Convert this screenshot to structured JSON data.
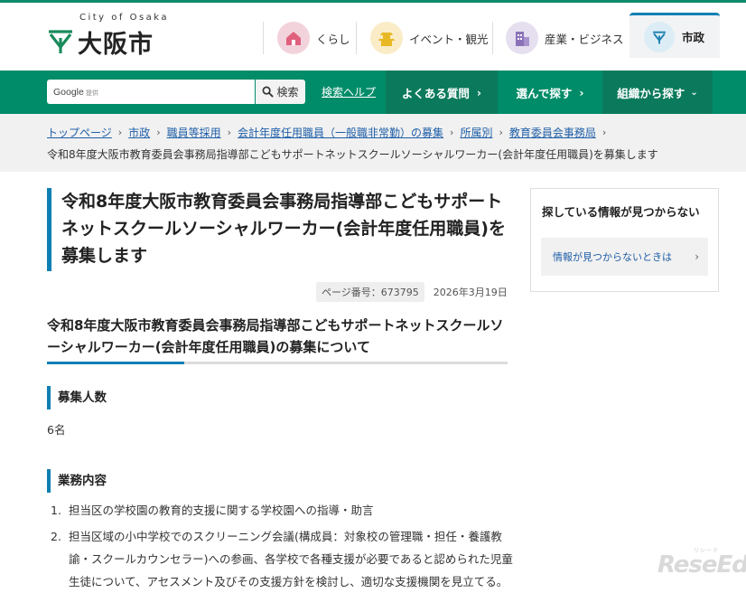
{
  "header": {
    "logo_en": "City of Osaka",
    "logo_ja": "大阪市",
    "nav": [
      {
        "label": "くらし",
        "icon": "house-icon",
        "color": "#f3d3db"
      },
      {
        "label": "イベント・観光",
        "icon": "castle-icon",
        "color": "#f9ecc7"
      },
      {
        "label": "産業・ビジネス",
        "icon": "building-icon",
        "color": "#e6dff0"
      },
      {
        "label": "市政",
        "icon": "city-emblem-icon",
        "color": "#dcedf6"
      }
    ]
  },
  "searchbar": {
    "brand": "Google",
    "brand_sub": "提供",
    "button": "検索",
    "help": "検索ヘルプ",
    "menus": [
      "よくある質問",
      "選んで探す",
      "組織から探す"
    ]
  },
  "breadcrumb": {
    "links": [
      "トップページ",
      "市政",
      "職員等採用",
      "会計年度任用職員（一般職非常勤）の募集",
      "所属別",
      "教育委員会事務局"
    ],
    "current": "令和8年度大阪市教育委員会事務局指導部こどもサポートネットスクールソーシャルワーカー(会計年度任用職員)を募集します"
  },
  "page": {
    "title": "令和8年度大阪市教育委員会事務局指導部こどもサポートネットスクールソーシャルワーカー(会計年度任用職員)を募集します",
    "page_number": "ページ番号：673795",
    "date": "2026年3月19日",
    "heading2": "令和8年度大阪市教育委員会事務局指導部こどもサポートネットスクールソーシャルワーカー(会計年度任用職員)の募集について",
    "section1_title": "募集人数",
    "section1_body": "6名",
    "section2_title": "業務内容",
    "section2_items": [
      "担当区の学校園の教育的支援に関する学校園への指導・助言",
      "担当区域の小中学校でのスクリーニング会議(構成員：対象校の管理職・担任・養護教諭・スクールカウンセラー)への参画、各学校で各種支援が必要であると認められた児童生徒について、アセスメント及びその支援方針を検討し、適切な支援機関を見立てる。"
    ]
  },
  "sidebar": {
    "title": "探している情報が見つからない",
    "link": "情報が見つからないときは"
  },
  "watermark": "ReseEd",
  "watermark_sub": "リシード",
  "colors": {
    "brand_green": "#008c68",
    "accent_blue": "#0f7fb3",
    "link": "#1f5fa8"
  }
}
